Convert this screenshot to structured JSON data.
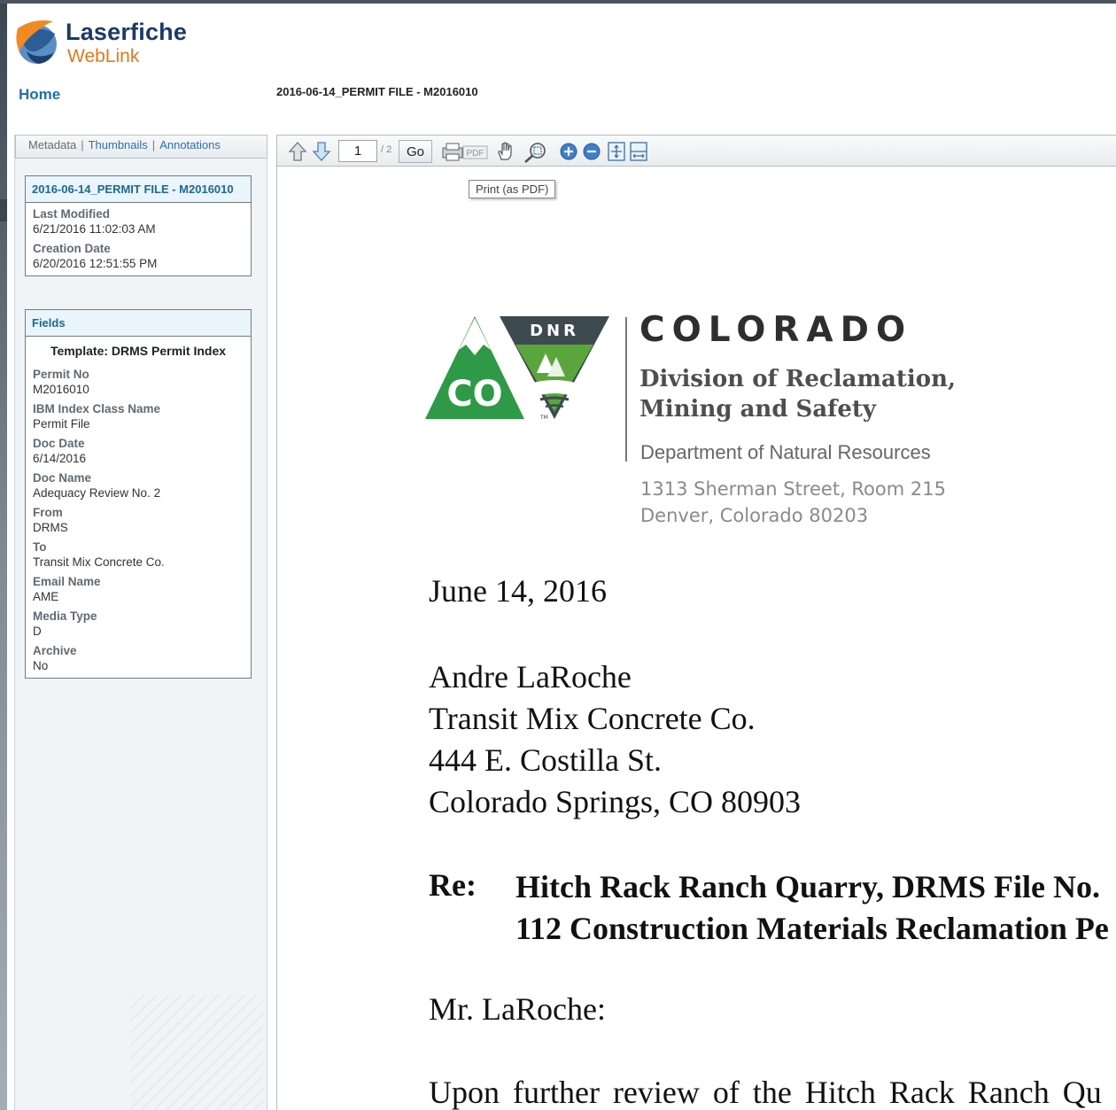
{
  "app": {
    "brand": "Laserfiche",
    "product": "WebLink"
  },
  "nav": {
    "home": "Home",
    "document_title": "2016-06-14_PERMIT FILE - M2016010"
  },
  "side_tabs": {
    "metadata": "Metadata",
    "thumbnails": "Thumbnails",
    "annotations": "Annotations",
    "separator": "|"
  },
  "metadata_box": {
    "title": "2016-06-14_PERMIT FILE - M2016010",
    "entries": [
      {
        "label": "Last Modified",
        "value": "6/21/2016 11:02:03 AM"
      },
      {
        "label": "Creation Date",
        "value": "6/20/2016 12:51:55 PM"
      }
    ]
  },
  "fields_box": {
    "title": "Fields",
    "template": "Template: DRMS Permit Index",
    "entries": [
      {
        "label": "Permit No",
        "value": "M2016010"
      },
      {
        "label": "IBM Index Class Name",
        "value": "Permit File"
      },
      {
        "label": "Doc Date",
        "value": "6/14/2016"
      },
      {
        "label": "Doc Name",
        "value": "Adequacy Review No. 2"
      },
      {
        "label": "From",
        "value": "DRMS"
      },
      {
        "label": "To",
        "value": "Transit Mix Concrete Co."
      },
      {
        "label": "Email Name",
        "value": "AME"
      },
      {
        "label": "Media Type",
        "value": "D"
      },
      {
        "label": "Archive",
        "value": "No"
      }
    ]
  },
  "toolbar": {
    "page_value": "1",
    "page_total": "/ 2",
    "go_label": "Go",
    "pdf_label": "PDF",
    "tooltip": "Print (as PDF)",
    "icons": [
      "prev-page-icon",
      "next-page-icon",
      "print-pdf-icon",
      "pan-hand-icon",
      "zoom-region-icon",
      "zoom-in-icon",
      "zoom-out-icon",
      "fit-page-icon",
      "fit-width-icon"
    ]
  },
  "letterhead": {
    "dnr": "DNR",
    "co": "CO",
    "tm": "TM",
    "state": "COLORADO",
    "division_line1": "Division of Reclamation,",
    "division_line2": "Mining and Safety",
    "department": "Department of Natural Resources",
    "address_line1": "1313 Sherman Street, Room 215",
    "address_line2": "Denver, Colorado 80203",
    "colors": {
      "green": "#2e9a47",
      "dark": "#3d4a4f"
    }
  },
  "letter": {
    "date": "June 14, 2016",
    "recipient": [
      "Andre LaRoche",
      "Transit Mix Concrete Co.",
      "444 E. Costilla St.",
      "Colorado Springs, CO 80903"
    ],
    "re_label": "Re:",
    "re_lines": [
      "Hitch Rack Ranch Quarry, DRMS File No.",
      "112 Construction Materials Reclamation Pe"
    ],
    "salutation": "Mr. LaRoche:",
    "body_start": "Upon further review of the Hitch Rack Ranch Qu"
  }
}
